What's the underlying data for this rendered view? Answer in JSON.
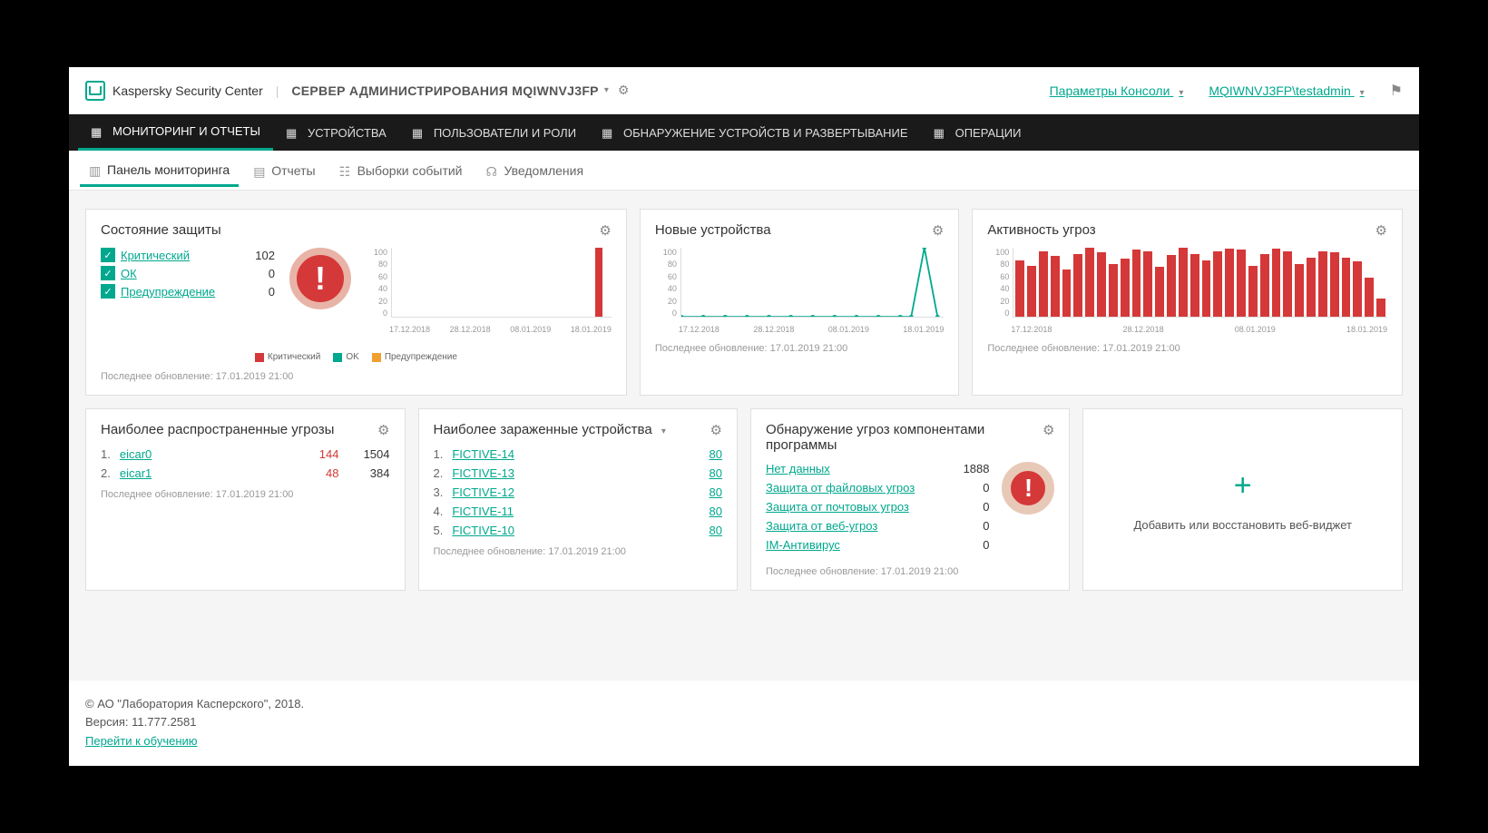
{
  "header": {
    "product": "Kaspersky Security Center",
    "server_label": "СЕРВЕР АДМИНИСТРИРОВАНИЯ MQIWNVJ3FP",
    "console_params": "Параметры Консоли",
    "user": "MQIWNVJ3FP\\testadmin"
  },
  "mainnav": [
    "МОНИТОРИНГ И ОТЧЕТЫ",
    "УСТРОЙСТВА",
    "ПОЛЬЗОВАТЕЛИ И РОЛИ",
    "ОБНАРУЖЕНИЕ УСТРОЙСТВ И РАЗВЕРТЫВАНИЕ",
    "ОПЕРАЦИИ"
  ],
  "subnav": [
    "Панель мониторинга",
    "Отчеты",
    "Выборки событий",
    "Уведомления"
  ],
  "widgets": {
    "protection": {
      "title": "Состояние защиты",
      "items": [
        {
          "label": "Критический",
          "value": 102
        },
        {
          "label": "ОК",
          "value": 0
        },
        {
          "label": "Предупреждение",
          "value": 0
        }
      ],
      "updated": "Последнее обновление: 17.01.2019 21:00",
      "legend": [
        "Критический",
        "OK",
        "Предупреждение"
      ]
    },
    "newdev": {
      "title": "Новые устройства",
      "updated": "Последнее обновление: 17.01.2019 21:00"
    },
    "threat_act": {
      "title": "Активность угроз",
      "updated": "Последнее обновление: 17.01.2019 21:00"
    },
    "common_threats": {
      "title": "Наиболее распространенные угрозы",
      "rows": [
        {
          "n": "1.",
          "name": "eicar0",
          "v1": 144,
          "v2": 1504
        },
        {
          "n": "2.",
          "name": "eicar1",
          "v1": 48,
          "v2": 384
        }
      ],
      "updated": "Последнее обновление: 17.01.2019 21:00"
    },
    "infected": {
      "title": "Наиболее зараженные устройства",
      "rows": [
        {
          "n": "1.",
          "name": "FICTIVE-14",
          "v": 80
        },
        {
          "n": "2.",
          "name": "FICTIVE-13",
          "v": 80
        },
        {
          "n": "3.",
          "name": "FICTIVE-12",
          "v": 80
        },
        {
          "n": "4.",
          "name": "FICTIVE-11",
          "v": 80
        },
        {
          "n": "5.",
          "name": "FICTIVE-10",
          "v": 80
        }
      ],
      "updated": "Последнее обновление: 17.01.2019 21:00"
    },
    "components": {
      "title": "Обнаружение угроз компонентами программы",
      "rows": [
        {
          "name": "Нет данных",
          "v": 1888
        },
        {
          "name": "Защита от файловых угроз",
          "v": 0
        },
        {
          "name": "Защита от почтовых угроз",
          "v": 0
        },
        {
          "name": "Защита от веб-угроз",
          "v": 0
        },
        {
          "name": "IM-Антивирус",
          "v": 0
        }
      ],
      "updated": "Последнее обновление: 17.01.2019 21:00"
    },
    "add": "Добавить или восстановить веб-виджет"
  },
  "chart_data": [
    {
      "type": "bar",
      "widget": "protection",
      "categories": [
        "17.12.2018",
        "28.12.2018",
        "08.01.2019",
        "18.01.2019"
      ],
      "series": [
        {
          "name": "Критический",
          "values_sparse": {
            "17.01.2019": 102
          }
        },
        {
          "name": "OK",
          "values_sparse": {}
        },
        {
          "name": "Предупреждение",
          "values_sparse": {}
        }
      ],
      "ylim": [
        0,
        100
      ],
      "yticks": [
        0,
        20,
        40,
        60,
        80,
        100
      ]
    },
    {
      "type": "line",
      "widget": "newdev",
      "categories": [
        "17.12.2018",
        "28.12.2018",
        "08.01.2019",
        "18.01.2019"
      ],
      "values_sparse": {
        "16.01.2019": 102,
        "default": 0
      },
      "ylim": [
        0,
        100
      ],
      "yticks": [
        0,
        20,
        40,
        60,
        80,
        100
      ]
    },
    {
      "type": "bar",
      "widget": "threat_act",
      "categories": [
        "17.12.2018",
        "28.12.2018",
        "08.01.2019",
        "18.01.2019"
      ],
      "values": [
        85,
        78,
        100,
        92,
        72,
        95,
        105,
        98,
        80,
        88,
        102,
        100,
        76,
        94,
        105,
        96,
        85,
        100,
        104,
        102,
        78,
        96,
        104,
        100,
        80,
        90,
        100,
        98,
        90,
        84,
        60,
        28
      ],
      "ylim": [
        0,
        100
      ],
      "yticks": [
        0,
        20,
        40,
        60,
        80,
        100
      ]
    }
  ],
  "footer": {
    "copyright": "© АО \"Лаборатория Касперского\", 2018.",
    "version": "Версия: 11.777.2581",
    "training": "Перейти к обучению"
  },
  "axis_dates": [
    "17.12.2018",
    "28.12.2018",
    "08.01.2019",
    "18.01.2019"
  ],
  "yticks": [
    "100",
    "80",
    "60",
    "40",
    "20",
    "0"
  ]
}
